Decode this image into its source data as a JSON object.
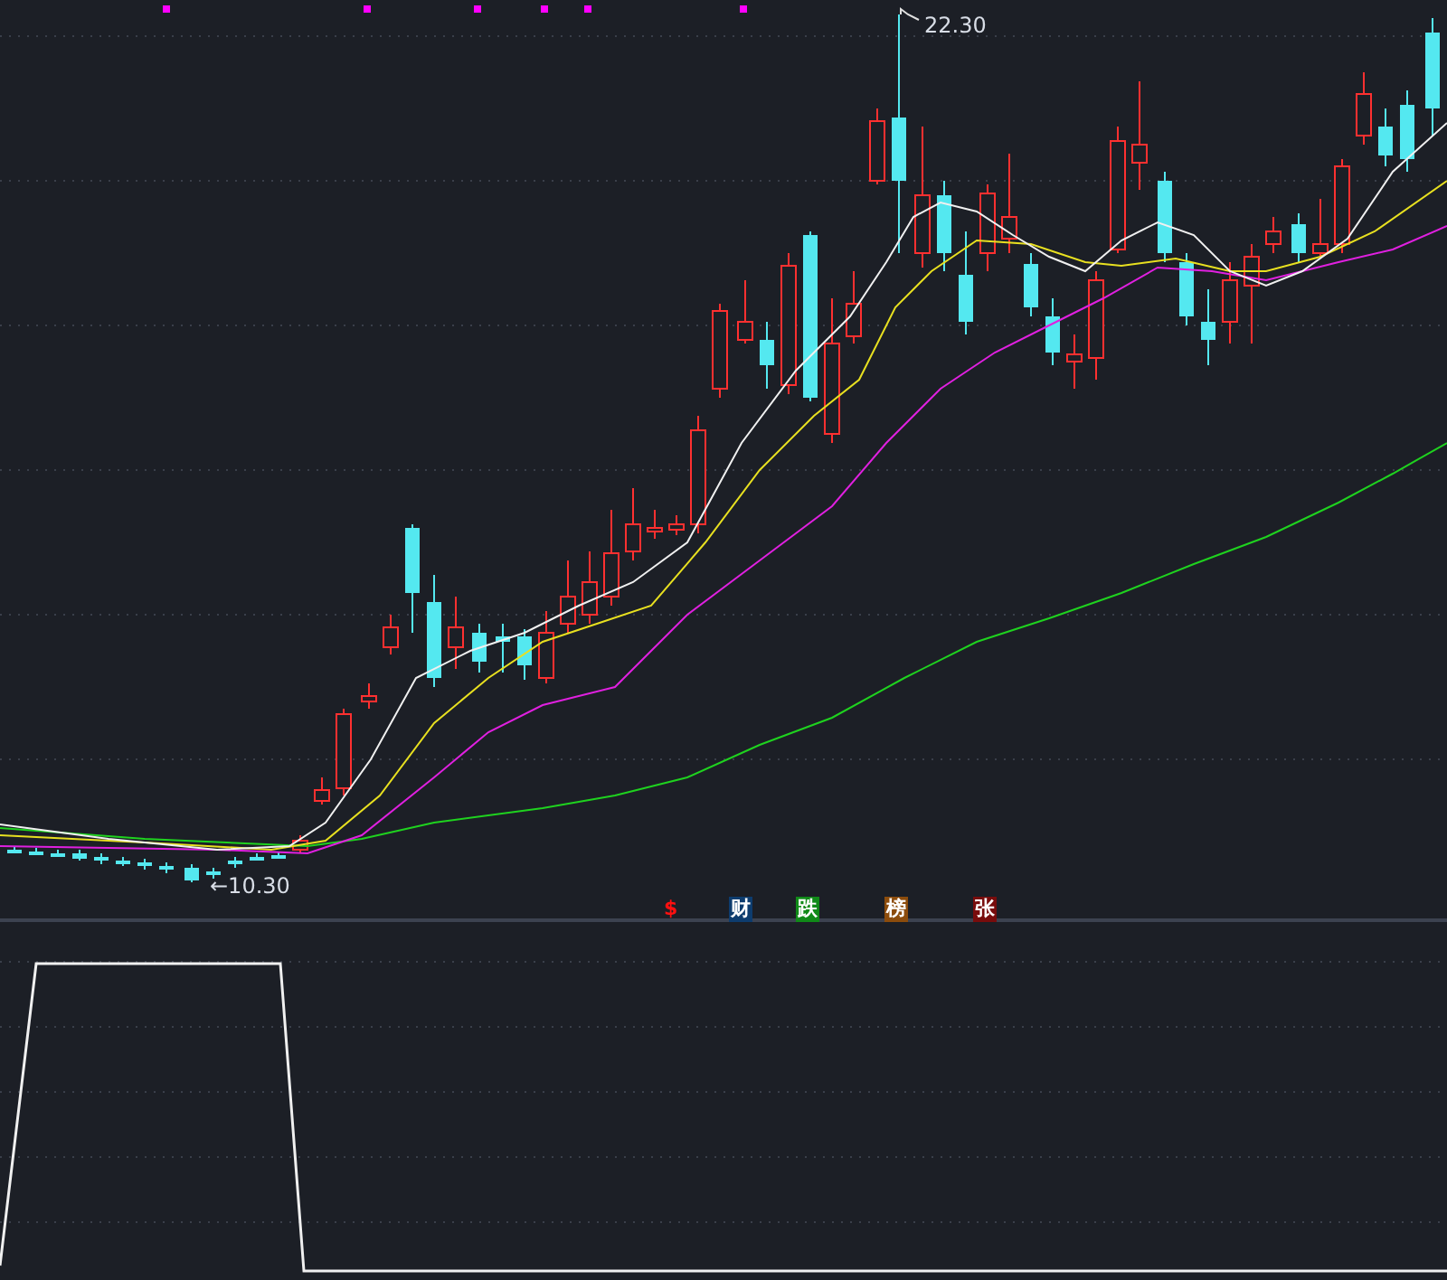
{
  "main_chart": {
    "high_label": "22.30",
    "low_label": "←10.30"
  },
  "signals": [
    {
      "text": "$",
      "kind": "plain",
      "color": "#ff1010"
    },
    {
      "text": "财",
      "kind": "box",
      "color": "#0d3c6e"
    },
    {
      "text": "跌",
      "kind": "box",
      "color": "#108a18"
    },
    {
      "text": "榜",
      "kind": "box",
      "color": "#8c4c0c"
    },
    {
      "text": "张",
      "kind": "box",
      "color": "#780c0c"
    }
  ]
}
